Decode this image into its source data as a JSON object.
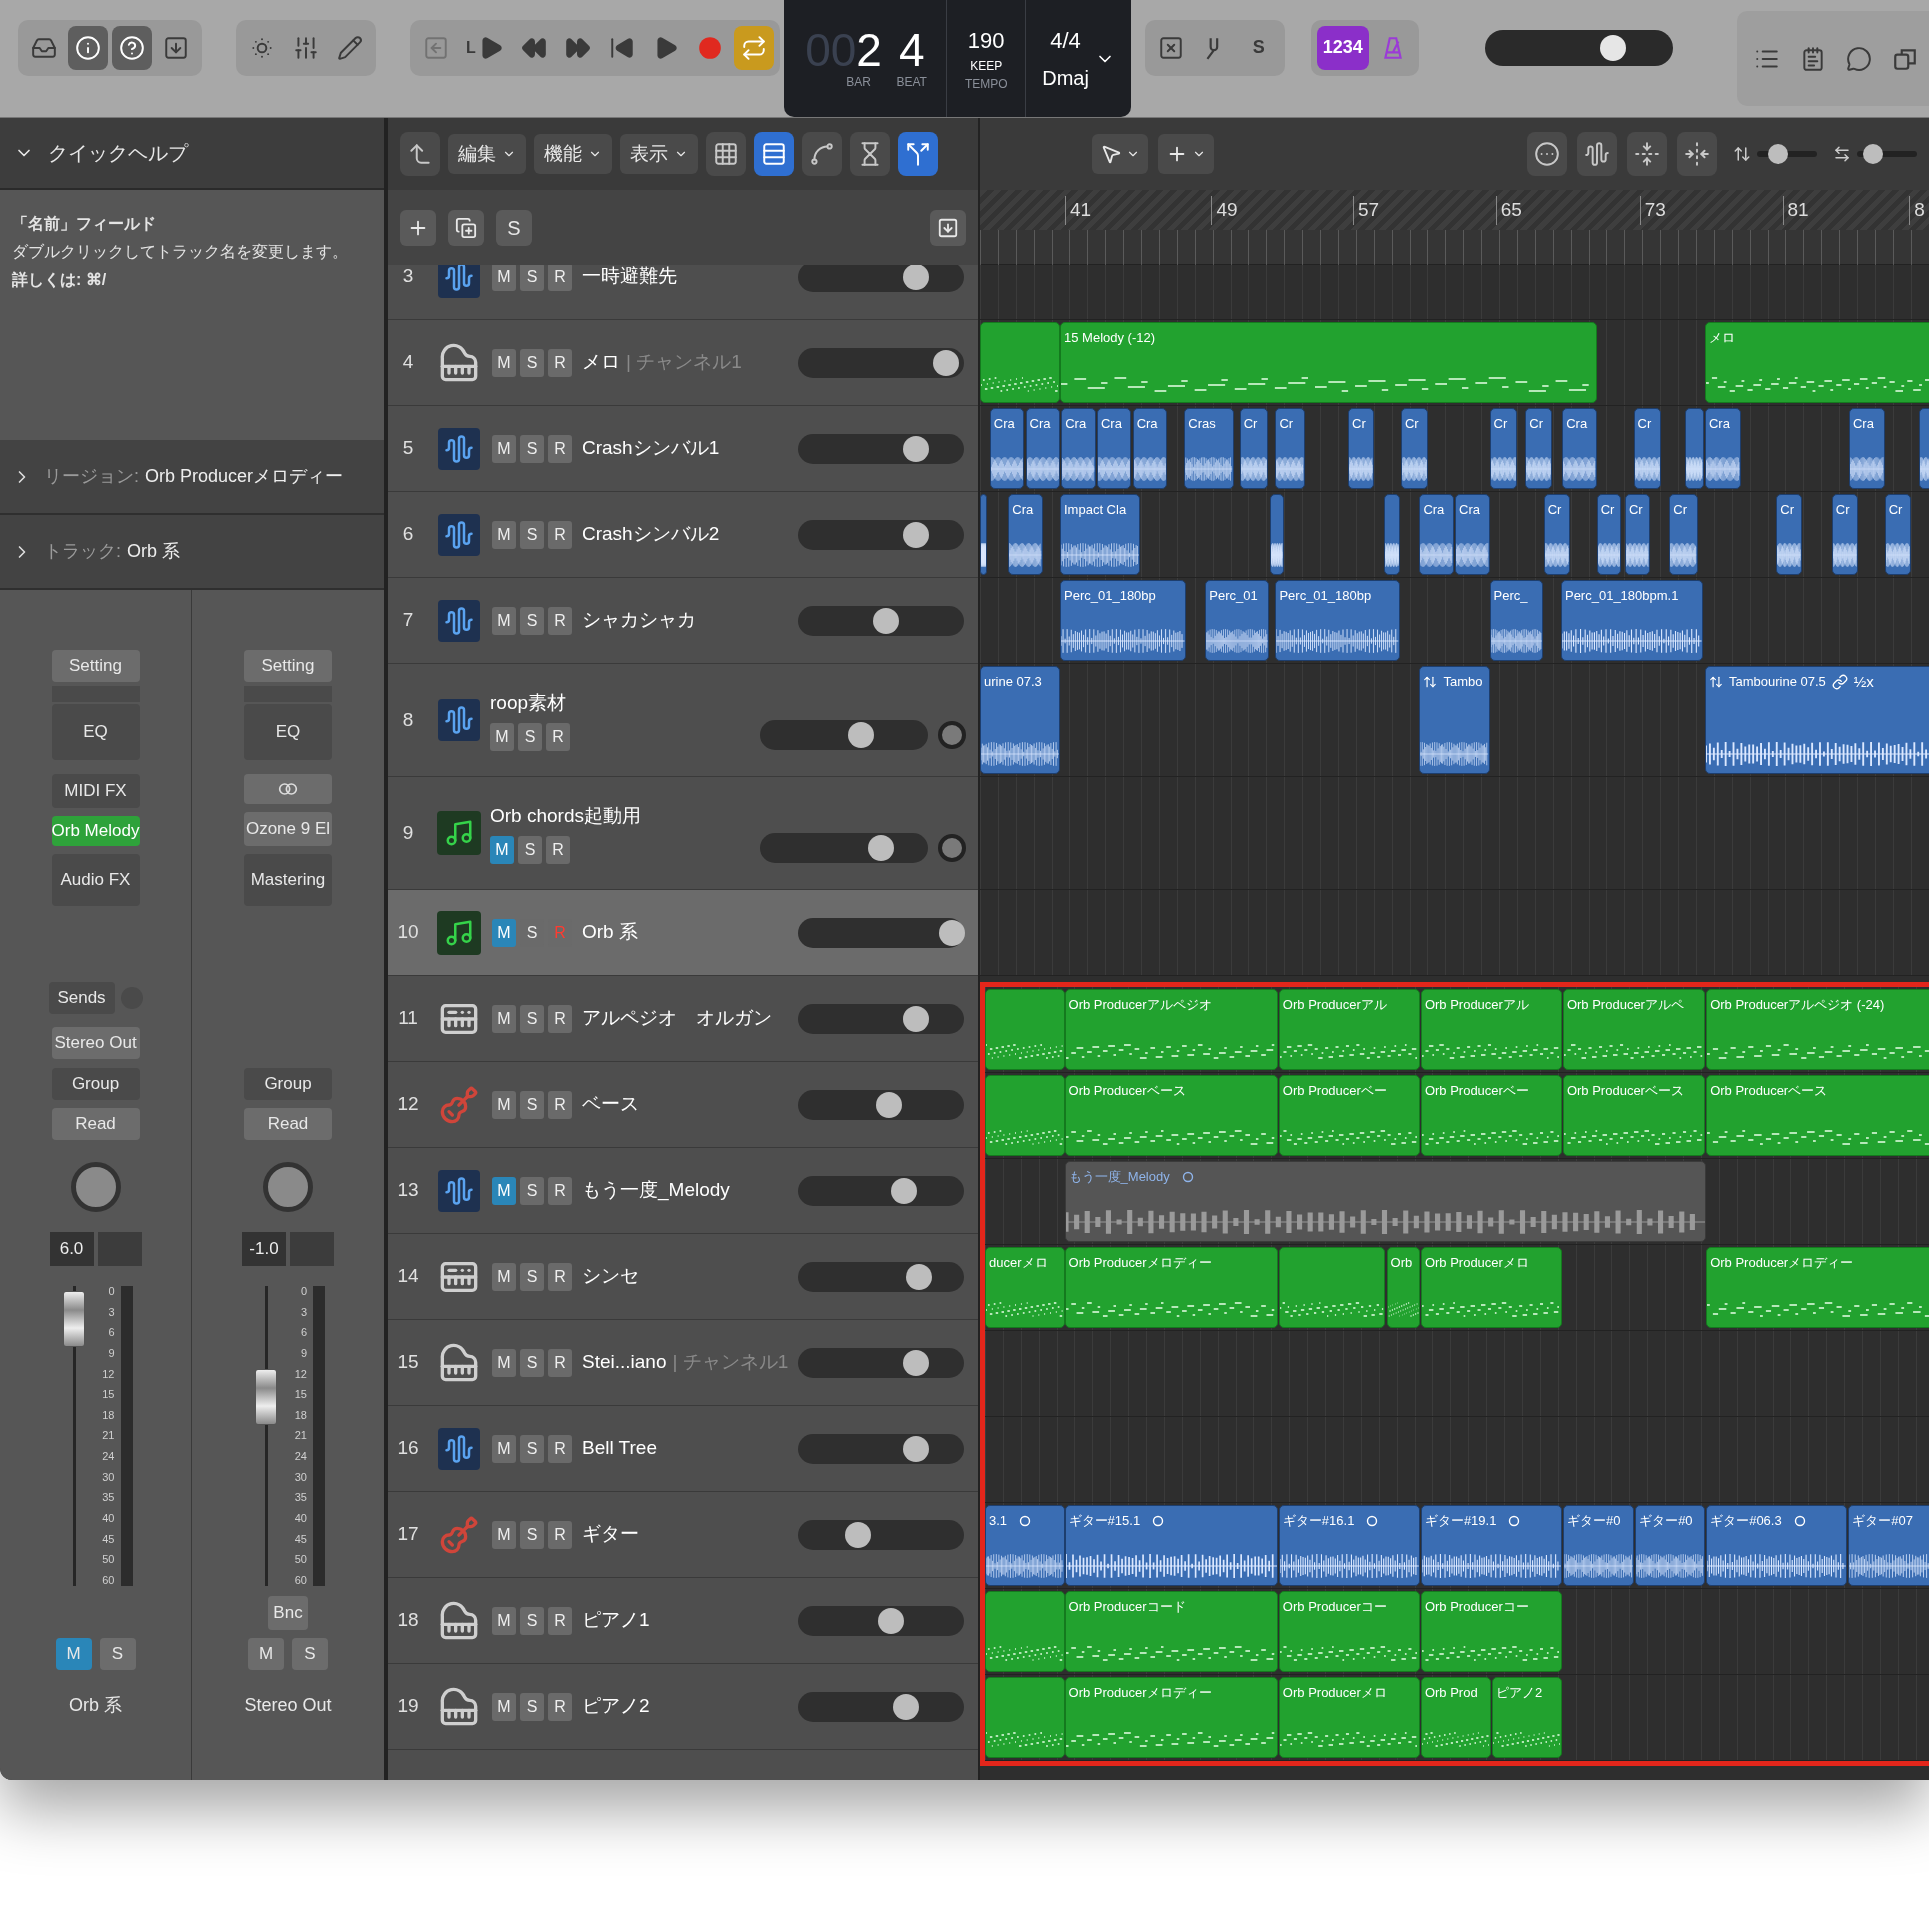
{
  "toolbar": {
    "groups": [
      {
        "items": [
          {
            "kind": "inbox",
            "active": false
          },
          {
            "kind": "info",
            "active": true
          },
          {
            "kind": "help",
            "active": true
          },
          {
            "kind": "download",
            "active": false
          }
        ]
      },
      {
        "items": [
          {
            "kind": "brightness",
            "active": false
          },
          {
            "kind": "mixer",
            "active": false
          },
          {
            "kind": "pencil",
            "active": false
          }
        ]
      },
      {
        "items": [
          {
            "kind": "back_left",
            "active": false,
            "disabled": true
          },
          {
            "kind": "play_left",
            "label": "L",
            "active": false,
            "disabled": false
          },
          {
            "kind": "rewind",
            "active": false,
            "disabled": false
          },
          {
            "kind": "forward",
            "active": false,
            "disabled": false
          },
          {
            "kind": "to_start",
            "active": false,
            "disabled": false
          },
          {
            "kind": "play",
            "active": false,
            "disabled": false
          },
          {
            "kind": "record",
            "active": false,
            "disabled": false
          },
          {
            "kind": "cycle",
            "active": true,
            "disabled": false
          }
        ]
      }
    ],
    "lcd": {
      "bar_dim": "00",
      "bar": "2",
      "beat": "4",
      "bar_label": "BAR",
      "beat_label": "BEAT",
      "tempo": "190",
      "tempo_mode": "KEEP",
      "tempo_label": "TEMPO",
      "signature": "4/4",
      "key": "Dmaj"
    },
    "groups_right": [
      {
        "items": [
          {
            "kind": "replace",
            "active": false
          },
          {
            "kind": "tuner",
            "active": false
          },
          {
            "kind": "solo_mode",
            "label": "S",
            "active": false
          }
        ]
      },
      {
        "items": [
          {
            "kind": "count_in",
            "label": "1234",
            "active": true
          },
          {
            "kind": "metronome",
            "active": true
          }
        ]
      }
    ],
    "master_volume": {
      "level": 0.68
    },
    "view_buttons": [
      {
        "kind": "list_editors"
      },
      {
        "kind": "notepad"
      },
      {
        "kind": "loops"
      },
      {
        "kind": "browser"
      }
    ]
  },
  "quick_help": {
    "title": "クイックヘルプ",
    "expanded": true,
    "heading": "「名前」フィールド",
    "text": "ダブルクリックしてトラック名を変更します。",
    "more": "詳しくは: ⌘/",
    "sections": [
      {
        "label": "リージョン:",
        "value": "Orb Producerメロディー",
        "expanded": false
      },
      {
        "label": "トラック:",
        "value": "Orb 系",
        "expanded": false
      }
    ]
  },
  "mixer": [
    {
      "setting": "Setting",
      "eq": "EQ",
      "slots": [
        {
          "kind": "label",
          "text": "MIDI FX"
        },
        {
          "kind": "instrument",
          "text": "Orb Melody"
        },
        {
          "kind": "label",
          "text": "Audio FX"
        }
      ],
      "sends": "Sends",
      "output": "Stereo Out",
      "group": "Group",
      "automation": "Read",
      "volume": "6.0",
      "fader": {
        "level": 0.98
      },
      "scale": [
        "0",
        "3",
        "6",
        "9",
        "12",
        "15",
        "18",
        "21",
        "24",
        "30",
        "35",
        "40",
        "45",
        "50",
        "60"
      ],
      "mute": {
        "label": "M",
        "on": true
      },
      "solo": {
        "label": "S",
        "on": false
      },
      "name": "Orb 系"
    },
    {
      "setting": "Setting",
      "eq": "EQ",
      "slots": [
        {
          "kind": "link"
        },
        {
          "kind": "plugin",
          "text": "Ozone 9 El"
        },
        {
          "kind": "label",
          "text": "Mastering"
        }
      ],
      "group": "Group",
      "automation": "Read",
      "volume": "-1.0",
      "fader": {
        "level": 0.66
      },
      "scale": [
        "0",
        "3",
        "6",
        "9",
        "12",
        "15",
        "18",
        "21",
        "24",
        "30",
        "35",
        "40",
        "45",
        "50",
        "60"
      ],
      "bounce": "Bnc",
      "mute": {
        "label": "M",
        "on": false
      },
      "solo": {
        "label": "S",
        "on": false
      },
      "name": "Stereo Out"
    }
  ],
  "tracks_toolbar": [
    {
      "kind": "back_up",
      "active": false
    },
    {
      "kind": "menu",
      "label": "編集",
      "active": false
    },
    {
      "kind": "menu",
      "label": "機能",
      "active": false
    },
    {
      "kind": "menu",
      "label": "表示",
      "active": false
    },
    {
      "kind": "grid_view",
      "active": false
    },
    {
      "kind": "list_view",
      "active": true
    },
    {
      "kind": "automation",
      "active": false
    },
    {
      "kind": "flex",
      "active": false
    },
    {
      "kind": "catch",
      "active": true
    }
  ],
  "track_header_buttons": [
    {
      "kind": "add"
    },
    {
      "kind": "duplicate"
    },
    {
      "kind": "solo_text",
      "label": "S"
    },
    {
      "kind": "download"
    }
  ],
  "arrange_toolbar": {
    "tools": [
      {
        "kind": "pointer"
      },
      {
        "kind": "crosshair"
      }
    ],
    "buttons": [
      {
        "kind": "more"
      },
      {
        "kind": "waveform"
      },
      {
        "kind": "v_zoom"
      },
      {
        "kind": "h_zoom"
      }
    ],
    "sliders": [
      {
        "kind": "vertical",
        "level": 0.35
      },
      {
        "kind": "horizontal",
        "level": 0.27
      }
    ]
  },
  "ruler": [
    "41",
    "49",
    "57",
    "65",
    "73",
    "81",
    "8"
  ],
  "tracks": [
    {
      "number": "3",
      "kind": "audio",
      "name": "一時避難先",
      "buttons": [
        {
          "label": "M",
          "on": false
        },
        {
          "label": "S",
          "on": false
        },
        {
          "label": "R",
          "on": false
        }
      ],
      "level": 0.71,
      "selected": false,
      "pan_knob": false,
      "framed": false
    },
    {
      "number": "4",
      "kind": "piano",
      "name": "メロ",
      "channel": "| チャンネル1",
      "buttons": [
        {
          "label": "M",
          "on": false
        },
        {
          "label": "S",
          "on": false
        },
        {
          "label": "R",
          "on": false
        }
      ],
      "level": 0.89,
      "selected": false,
      "pan_knob": false,
      "framed": false,
      "regions": [
        {
          "kind": "midi"
        },
        {
          "kind": "midi",
          "label": "15 Melody (-12)"
        },
        {
          "kind": "midi",
          "label": "メロ"
        }
      ]
    },
    {
      "number": "5",
      "kind": "audio",
      "name": "Crashシンバル1",
      "buttons": [
        {
          "label": "M",
          "on": false
        },
        {
          "label": "S",
          "on": false
        },
        {
          "label": "R",
          "on": false
        }
      ],
      "level": 0.71,
      "selected": false,
      "pan_knob": false,
      "framed": false,
      "regions": [
        {
          "kind": "audio",
          "label": "Cra"
        },
        {
          "kind": "audio",
          "label": "Cra"
        },
        {
          "kind": "audio",
          "label": "Cra"
        },
        {
          "kind": "audio",
          "label": "Cra"
        },
        {
          "kind": "audio",
          "label": "Cra"
        },
        {
          "kind": "audio",
          "label": "Cras"
        },
        {
          "kind": "audio",
          "label": "Cr"
        },
        {
          "kind": "audio",
          "label": "Cr"
        },
        {
          "kind": "audio",
          "label": "Cr"
        },
        {
          "kind": "audio",
          "label": "Cr"
        },
        {
          "kind": "audio",
          "label": "Cr"
        },
        {
          "kind": "audio",
          "label": "Cr"
        },
        {
          "kind": "audio",
          "label": "Cra"
        },
        {
          "kind": "audio",
          "label": "Cr"
        },
        {
          "kind": "audio"
        },
        {
          "kind": "audio",
          "label": "Cra"
        },
        {
          "kind": "audio",
          "label": "Cra"
        },
        {
          "kind": "audio"
        }
      ]
    },
    {
      "number": "6",
      "kind": "audio",
      "name": "Crashシンバル2",
      "buttons": [
        {
          "label": "M",
          "on": false
        },
        {
          "label": "S",
          "on": false
        },
        {
          "label": "R",
          "on": false
        }
      ],
      "level": 0.71,
      "selected": false,
      "pan_knob": false,
      "framed": false,
      "regions": [
        {
          "kind": "audio"
        },
        {
          "kind": "audio",
          "label": "Cra"
        },
        {
          "kind": "audio",
          "label": "Impact Cla"
        },
        {
          "kind": "audio"
        },
        {
          "kind": "audio"
        },
        {
          "kind": "audio",
          "label": "Cra"
        },
        {
          "kind": "audio",
          "label": "Cra"
        },
        {
          "kind": "audio",
          "label": "Cr"
        },
        {
          "kind": "audio",
          "label": "Cr"
        },
        {
          "kind": "audio",
          "label": "Cr"
        },
        {
          "kind": "audio",
          "label": "Cr"
        },
        {
          "kind": "audio",
          "label": "Cr"
        },
        {
          "kind": "audio",
          "label": "Cr"
        },
        {
          "kind": "audio",
          "label": "Cr"
        }
      ]
    },
    {
      "number": "7",
      "kind": "audio",
      "name": "シャカシャカ",
      "buttons": [
        {
          "label": "M",
          "on": false
        },
        {
          "label": "S",
          "on": false
        },
        {
          "label": "R",
          "on": false
        }
      ],
      "level": 0.53,
      "selected": false,
      "pan_knob": false,
      "framed": false,
      "regions": [
        {
          "kind": "audio",
          "label": "Perc_01_180bp"
        },
        {
          "kind": "audio",
          "label": "Perc_01"
        },
        {
          "kind": "audio",
          "label": "Perc_01_180bp"
        },
        {
          "kind": "audio",
          "label": "Perc_"
        },
        {
          "kind": "audio",
          "label": "Perc_01_180bpm.1"
        }
      ]
    },
    {
      "number": "8",
      "kind": "audio",
      "name": "roop素材",
      "buttons": [
        {
          "label": "M",
          "on": false
        },
        {
          "label": "S",
          "on": false
        },
        {
          "label": "R",
          "on": false
        }
      ],
      "level": 0.6,
      "selected": false,
      "pan_knob": true,
      "framed": false,
      "regions": [
        {
          "kind": "audio",
          "label": "urine 07.3",
          "flex": false,
          "linked": false
        },
        {
          "kind": "audio",
          "label": "Tambo",
          "flex": true,
          "linked": false
        },
        {
          "kind": "audio",
          "label": "Tambourine 07.5",
          "flex": true,
          "linked": true,
          "speed": "½x"
        }
      ]
    },
    {
      "number": "9",
      "kind": "midi",
      "name": "Orb chords起動用",
      "buttons": [
        {
          "label": "M",
          "on": true
        },
        {
          "label": "S",
          "on": false
        },
        {
          "label": "R",
          "on": false
        }
      ],
      "level": 0.72,
      "selected": false,
      "pan_knob": true,
      "framed": false
    },
    {
      "number": "10",
      "kind": "midi",
      "name": "Orb 系",
      "buttons": [
        {
          "label": "M",
          "on": true
        },
        {
          "label": "S",
          "on": false
        },
        {
          "label": "R",
          "on": true
        }
      ],
      "level": 0.93,
      "selected": true,
      "pan_knob": false,
      "framed": false
    },
    {
      "number": "11",
      "kind": "keyboard",
      "name": "アルペジオ　オルガン",
      "buttons": [
        {
          "label": "M",
          "on": false
        },
        {
          "label": "S",
          "on": false
        },
        {
          "label": "R",
          "on": false
        }
      ],
      "level": 0.71,
      "selected": false,
      "pan_knob": false,
      "framed": true,
      "regions": [
        {
          "kind": "midi"
        },
        {
          "kind": "midi",
          "label": "Orb Producerアルペジオ"
        },
        {
          "kind": "midi",
          "label": "Orb Producerアル"
        },
        {
          "kind": "midi",
          "label": "Orb Producerアル"
        },
        {
          "kind": "midi",
          "label": "Orb Producerアルペ"
        },
        {
          "kind": "midi",
          "label": "Orb Producerアルペジオ (-24)"
        }
      ]
    },
    {
      "number": "12",
      "kind": "guitar",
      "name": "ベース",
      "buttons": [
        {
          "label": "M",
          "on": false
        },
        {
          "label": "S",
          "on": false
        },
        {
          "label": "R",
          "on": false
        }
      ],
      "level": 0.55,
      "selected": false,
      "pan_knob": false,
      "framed": true,
      "regions": [
        {
          "kind": "midi"
        },
        {
          "kind": "midi",
          "label": "Orb Producerベース"
        },
        {
          "kind": "midi",
          "label": "Orb Producerベー"
        },
        {
          "kind": "midi",
          "label": "Orb Producerベー"
        },
        {
          "kind": "midi",
          "label": "Orb Producerベース"
        },
        {
          "kind": "midi",
          "label": "Orb Producerベース"
        }
      ]
    },
    {
      "number": "13",
      "kind": "audio",
      "name": "もう一度_Melody",
      "buttons": [
        {
          "label": "M",
          "on": true
        },
        {
          "label": "S",
          "on": false
        },
        {
          "label": "R",
          "on": false
        }
      ],
      "level": 0.64,
      "selected": false,
      "pan_knob": false,
      "framed": true,
      "regions": [
        {
          "kind": "muted",
          "label": "もう一度_Melody",
          "loop": true
        }
      ]
    },
    {
      "number": "14",
      "kind": "keyboard",
      "name": "シンセ",
      "buttons": [
        {
          "label": "M",
          "on": false
        },
        {
          "label": "S",
          "on": false
        },
        {
          "label": "R",
          "on": false
        }
      ],
      "level": 0.73,
      "selected": false,
      "pan_knob": false,
      "framed": true,
      "regions": [
        {
          "kind": "midi",
          "label": "ducerメロ"
        },
        {
          "kind": "midi",
          "label": "Orb Producerメロディー"
        },
        {
          "kind": "midi"
        },
        {
          "kind": "midi",
          "label": "Orb"
        },
        {
          "kind": "midi",
          "label": "Orb Producerメロ"
        },
        {
          "kind": "midi",
          "label": "Orb Producerメロディー"
        }
      ]
    },
    {
      "number": "15",
      "kind": "piano",
      "name": "Stei...iano",
      "channel": "| チャンネル1",
      "buttons": [
        {
          "label": "M",
          "on": false
        },
        {
          "label": "S",
          "on": false
        },
        {
          "label": "R",
          "on": false
        }
      ],
      "level": 0.71,
      "selected": false,
      "pan_knob": false,
      "framed": true
    },
    {
      "number": "16",
      "kind": "audio",
      "name": "Bell Tree",
      "buttons": [
        {
          "label": "M",
          "on": false
        },
        {
          "label": "S",
          "on": false
        },
        {
          "label": "R",
          "on": false
        }
      ],
      "level": 0.71,
      "selected": false,
      "pan_knob": false,
      "framed": true
    },
    {
      "number": "17",
      "kind": "guitar",
      "name": "ギター",
      "buttons": [
        {
          "label": "M",
          "on": false
        },
        {
          "label": "S",
          "on": false
        },
        {
          "label": "R",
          "on": false
        }
      ],
      "level": 0.36,
      "selected": false,
      "pan_knob": false,
      "framed": true,
      "regions": [
        {
          "kind": "audio",
          "label": "3.1",
          "loop": true
        },
        {
          "kind": "audio",
          "label": "ギター#15.1",
          "loop": true
        },
        {
          "kind": "audio",
          "label": "ギター#16.1",
          "loop": true
        },
        {
          "kind": "audio",
          "label": "ギター#19.1",
          "loop": true
        },
        {
          "kind": "audio",
          "label": "ギター#0",
          "loop": false
        },
        {
          "kind": "audio",
          "label": "ギター#0",
          "loop": false
        },
        {
          "kind": "audio",
          "label": "ギター#06.3",
          "loop": true
        },
        {
          "kind": "audio",
          "label": "ギター#07",
          "loop": false
        }
      ]
    },
    {
      "number": "18",
      "kind": "piano",
      "name": "ピアノ1",
      "buttons": [
        {
          "label": "M",
          "on": false
        },
        {
          "label": "S",
          "on": false
        },
        {
          "label": "R",
          "on": false
        }
      ],
      "level": 0.56,
      "selected": false,
      "pan_knob": false,
      "framed": true,
      "regions": [
        {
          "kind": "midi"
        },
        {
          "kind": "midi",
          "label": "Orb Producerコード"
        },
        {
          "kind": "midi",
          "label": "Orb Producerコー"
        },
        {
          "kind": "midi",
          "label": "Orb Producerコー"
        }
      ]
    },
    {
      "number": "19",
      "kind": "piano",
      "name": "ピアノ2",
      "buttons": [
        {
          "label": "M",
          "on": false
        },
        {
          "label": "S",
          "on": false
        },
        {
          "label": "R",
          "on": false
        }
      ],
      "level": 0.65,
      "selected": false,
      "pan_knob": false,
      "framed": true,
      "regions": [
        {
          "kind": "midi"
        },
        {
          "kind": "midi",
          "label": "Orb Producerメロディー"
        },
        {
          "kind": "midi",
          "label": "Orb Producerメロ"
        },
        {
          "kind": "midi",
          "label": "Orb Prod"
        },
        {
          "kind": "midi",
          "label": "ピアノ2"
        }
      ]
    }
  ]
}
